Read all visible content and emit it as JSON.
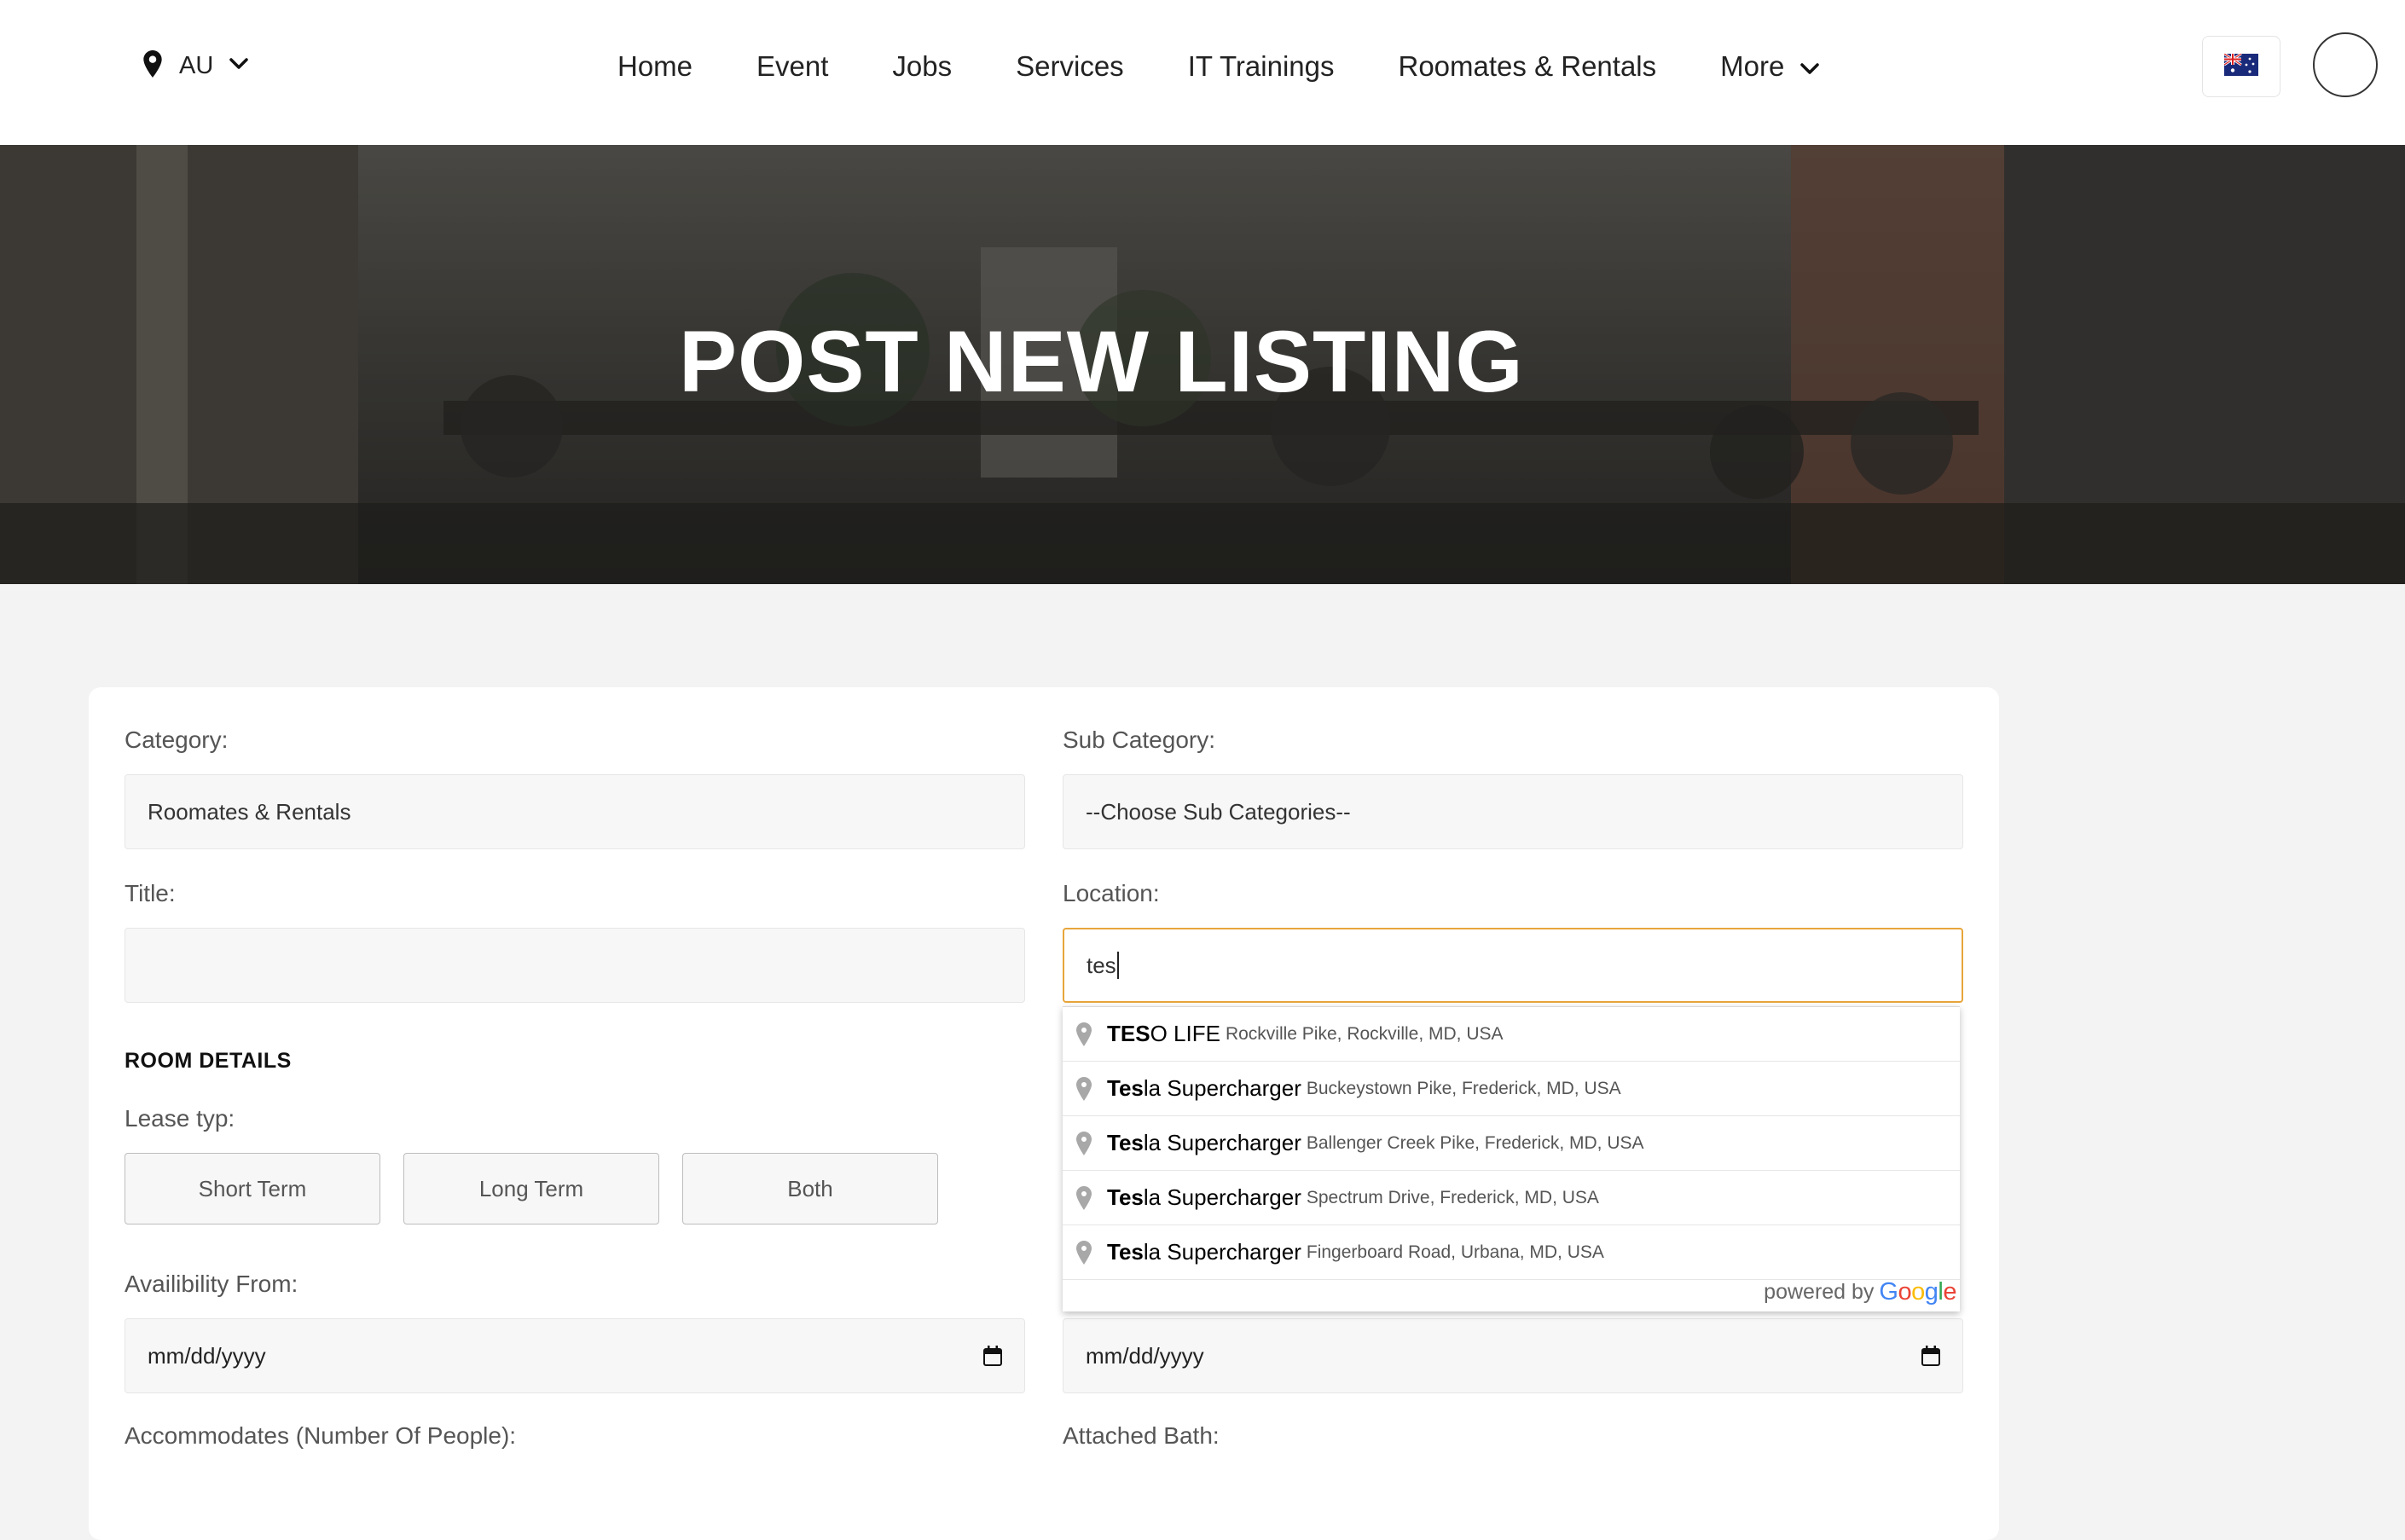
{
  "header": {
    "location_code": "AU",
    "nav": [
      "Home",
      "Event",
      "Jobs",
      "Services",
      "IT Trainings",
      "Roomates & Rentals",
      "More"
    ]
  },
  "hero": {
    "title": "POST NEW LISTING"
  },
  "form": {
    "category_label": "Category:",
    "category_value": "Roomates & Rentals",
    "subcategory_label": "Sub Category:",
    "subcategory_value": "--Choose Sub Categories--",
    "title_label": "Title:",
    "title_value": "",
    "location_label": "Location:",
    "location_value": "tes",
    "room_details_heading": "ROOM DETAILS",
    "lease_label": "Lease typ:",
    "lease_options": [
      "Short Term",
      "Long Term",
      "Both"
    ],
    "availability_label": "Availibility From:",
    "date_placeholder": "mm/dd/yyyy",
    "date2_placeholder": "mm/dd/yyyy",
    "accommodates_label": "Accommodates (Number Of People):",
    "attached_bath_label": "Attached Bath:"
  },
  "autocomplete": {
    "items": [
      {
        "match": "TES",
        "rest": "O LIFE",
        "secondary": "Rockville Pike, Rockville, MD, USA"
      },
      {
        "match": "Tes",
        "rest": "la Supercharger",
        "secondary": "Buckeystown Pike, Frederick, MD, USA"
      },
      {
        "match": "Tes",
        "rest": "la Supercharger",
        "secondary": "Ballenger Creek Pike, Frederick, MD, USA"
      },
      {
        "match": "Tes",
        "rest": "la Supercharger",
        "secondary": "Spectrum Drive, Frederick, MD, USA"
      },
      {
        "match": "Tes",
        "rest": "la Supercharger",
        "secondary": "Fingerboard Road, Urbana, MD, USA"
      }
    ],
    "powered_by": "powered by",
    "google": "Google"
  },
  "colors": {
    "focus_border": "#e8a53a",
    "page_bg": "#f3f3f4"
  }
}
